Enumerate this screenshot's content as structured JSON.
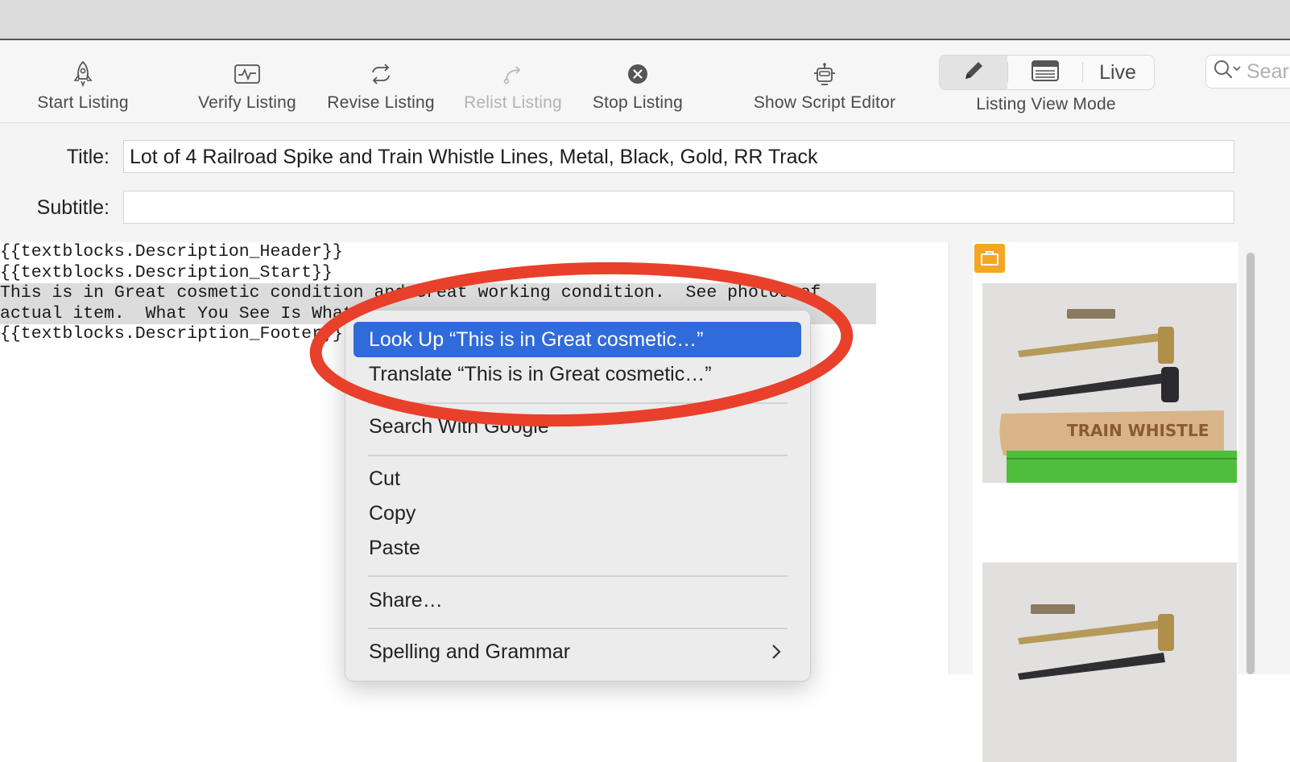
{
  "toolbar": {
    "items": [
      {
        "label": "Start Listing",
        "icon": "rocket-icon",
        "enabled": true
      },
      {
        "label": "Verify Listing",
        "icon": "pulse-icon",
        "enabled": true
      },
      {
        "label": "Revise Listing",
        "icon": "revise-icon",
        "enabled": true
      },
      {
        "label": "Relist Listing",
        "icon": "relist-icon",
        "enabled": false
      },
      {
        "label": "Stop Listing",
        "icon": "stop-icon",
        "enabled": true
      },
      {
        "label": "Show Script Editor",
        "icon": "robot-icon",
        "enabled": true
      }
    ],
    "view_mode": {
      "label": "Listing View Mode",
      "options": [
        "edit",
        "preview",
        "Live"
      ],
      "live_label": "Live",
      "selected": "edit"
    },
    "search": {
      "placeholder": "Sear"
    }
  },
  "form": {
    "title_label": "Title:",
    "title_value": "Lot of 4 Railroad Spike and Train Whistle Lines, Metal, Black, Gold, RR Track",
    "subtitle_label": "Subtitle:",
    "subtitle_value": ""
  },
  "editor": {
    "lines": [
      "{{textblocks.Description_Header}}",
      "{{textblocks.Description_Start}}",
      "This is in Great cosmetic condition and Great working condition.  See photos of",
      "actual item.  What You See Is What",
      "{{textblocks.Description_Footer}}"
    ]
  },
  "context_menu": {
    "items": [
      {
        "label": "Look Up “This is in Great cosmetic…”",
        "highlighted": true
      },
      {
        "label": "Translate “This is in Great cosmetic…”"
      },
      {
        "label": "Search With Google"
      },
      {
        "label": "Cut"
      },
      {
        "label": "Copy"
      },
      {
        "label": "Paste"
      },
      {
        "label": "Share…"
      },
      {
        "label": "Spelling and Grammar",
        "submenu": true
      }
    ]
  },
  "annotation": {
    "color": "#e8402a",
    "shape": "ellipse"
  },
  "colors": {
    "highlight": "#2f6bdb",
    "badge": "#f5a623"
  }
}
